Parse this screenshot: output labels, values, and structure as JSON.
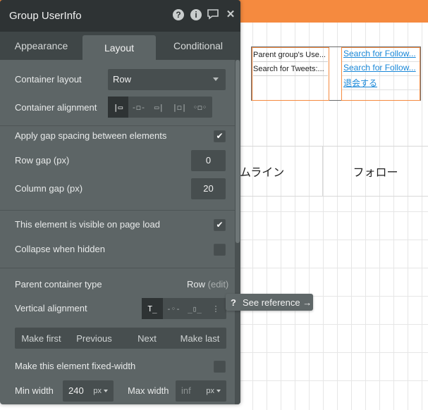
{
  "panel": {
    "title": "Group UserInfo",
    "tabs": [
      "Appearance",
      "Layout",
      "Conditional"
    ],
    "active_tab": "Layout"
  },
  "layout": {
    "container_layout_label": "Container layout",
    "container_layout_value": "Row",
    "container_alignment_label": "Container alignment",
    "gap_spacing_label": "Apply gap spacing between elements",
    "gap_spacing_checked": true,
    "row_gap_label": "Row gap (px)",
    "row_gap_value": "0",
    "column_gap_label": "Column gap (px)",
    "column_gap_value": "20",
    "visible_label": "This element is visible on page load",
    "visible_checked": true,
    "collapse_label": "Collapse when hidden",
    "collapse_checked": false,
    "parent_type_label": "Parent container type",
    "parent_type_value": "Row",
    "parent_type_edit": "(edit)",
    "vertical_alignment_label": "Vertical alignment",
    "order_buttons": [
      "Make first",
      "Previous",
      "Next",
      "Make last"
    ],
    "fixed_width_label": "Make this element fixed-width",
    "fixed_width_checked": false,
    "min_width_label": "Min width",
    "min_width_value": "240",
    "min_width_unit": "px",
    "max_width_label": "Max width",
    "max_width_placeholder": "inf",
    "max_width_unit": "px"
  },
  "tooltip": {
    "text": "See reference →"
  },
  "canvas": {
    "text1": "Parent group's Use...",
    "text2": "Search for Tweets:...",
    "link1": "Search for Follow...",
    "link2": "Search for Follow...",
    "link3": "退会する",
    "tab1": "ムライン",
    "tab2": "フォロー"
  },
  "icons": {
    "help": "question-circle-icon",
    "info": "info-circle-icon",
    "comment": "comment-icon",
    "close": "close-icon",
    "check": "checkmark-icon"
  },
  "colors": {
    "panel_bg": "#5d6566",
    "panel_header": "#2e3334",
    "accent_orange": "#f58a3f",
    "link_blue": "#1a88d8"
  }
}
